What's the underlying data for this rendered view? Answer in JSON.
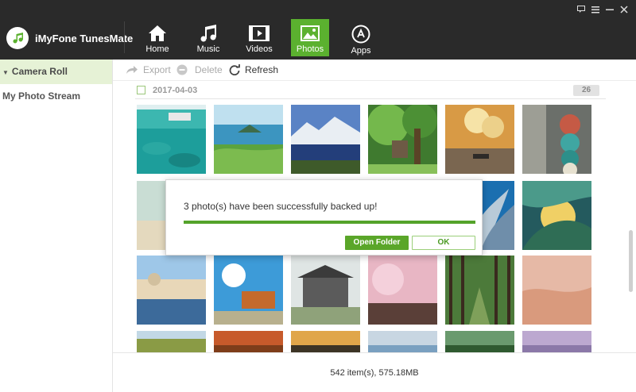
{
  "app": {
    "title": "iMyFone TunesMate"
  },
  "window_controls": [
    "feedback-icon",
    "menu-icon",
    "minimize-icon",
    "close-icon"
  ],
  "nav": {
    "tabs": [
      {
        "label": "Home",
        "icon": "home-icon",
        "active": false
      },
      {
        "label": "Music",
        "icon": "music-icon",
        "active": false
      },
      {
        "label": "Videos",
        "icon": "videos-icon",
        "active": false
      },
      {
        "label": "Photos",
        "icon": "photos-icon",
        "active": true
      },
      {
        "label": "Apps",
        "icon": "apps-icon",
        "active": false
      }
    ]
  },
  "sidebar": {
    "items": [
      {
        "label": "Camera Roll",
        "active": true
      },
      {
        "label": "My Photo Stream",
        "active": false
      }
    ]
  },
  "toolbar": {
    "export_label": "Export",
    "delete_label": "Delete",
    "refresh_label": "Refresh"
  },
  "group": {
    "date": "2017-04-03",
    "count": "26"
  },
  "dialog": {
    "message": "3 photo(s) have been successfully backed up!",
    "progress": 1.0,
    "open_folder_label": "Open Folder",
    "ok_label": "OK"
  },
  "footer": {
    "summary": "542 item(s), 575.18MB"
  },
  "colors": {
    "accent": "#5bb12f",
    "header_bg": "#2a2a2a",
    "sidebar_active": "#e6f2d6"
  }
}
